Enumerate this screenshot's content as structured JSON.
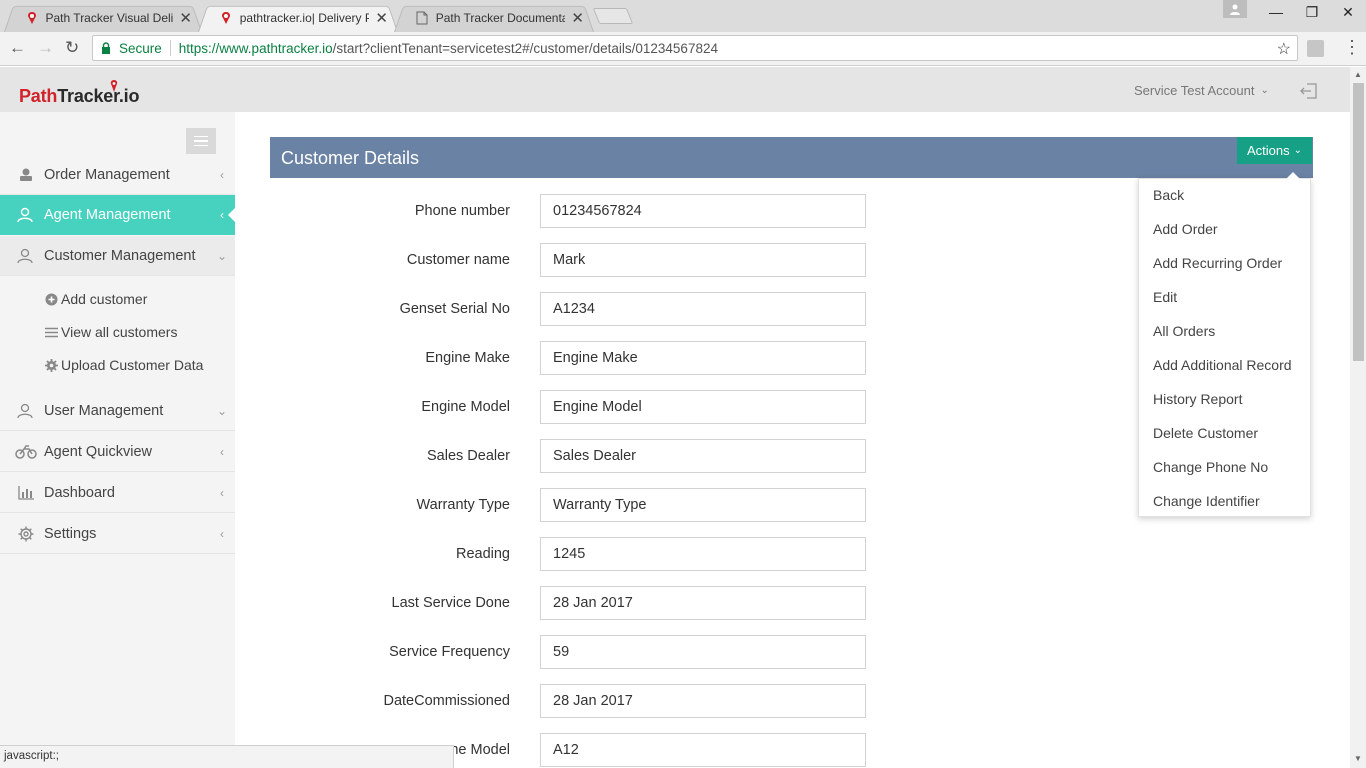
{
  "browser": {
    "tabs": [
      {
        "title": "Path Tracker Visual Delive",
        "active": false
      },
      {
        "title": "pathtracker.io| Delivery P",
        "active": true
      },
      {
        "title": "Path Tracker Documentat",
        "active": false
      }
    ],
    "secure_label": "Secure",
    "url_host": "https://www.pathtracker.io",
    "url_path": "/start?clientTenant=servicetest2#/customer/details/01234567824",
    "status_text": "javascript:;"
  },
  "header": {
    "logo_part1": "Path",
    "logo_part2": "Tracker.io",
    "account_label": "Service Test Account"
  },
  "sidebar": {
    "items": [
      {
        "label": "Order Management",
        "icon": "order-icon"
      },
      {
        "label": "Agent Management",
        "icon": "agent-icon"
      },
      {
        "label": "Customer Management",
        "icon": "customer-icon"
      },
      {
        "label": "User Management",
        "icon": "user-icon"
      },
      {
        "label": "Agent Quickview",
        "icon": "bike-icon"
      },
      {
        "label": "Dashboard",
        "icon": "bar-chart-icon"
      },
      {
        "label": "Settings",
        "icon": "gear-icon"
      }
    ],
    "sub_items": [
      {
        "label": "Add customer",
        "icon": "plus-circle-icon"
      },
      {
        "label": "View all customers",
        "icon": "list-icon"
      },
      {
        "label": "Upload Customer Data",
        "icon": "gear-icon"
      }
    ]
  },
  "panel": {
    "title": "Customer Details",
    "actions_label": "Actions"
  },
  "actions_menu": [
    "Back",
    "Add Order",
    "Add Recurring Order",
    "Edit",
    "All Orders",
    "Add Additional Record",
    "History Report",
    "Delete Customer",
    "Change Phone No",
    "Change Identifier"
  ],
  "fields": [
    {
      "label": "Phone number",
      "value": "01234567824"
    },
    {
      "label": "Customer name",
      "value": "Mark"
    },
    {
      "label": "Genset Serial No",
      "value": "A1234"
    },
    {
      "label": "Engine Make",
      "value": "Engine Make"
    },
    {
      "label": "Engine Model",
      "value": "Engine Model"
    },
    {
      "label": "Sales Dealer",
      "value": "Sales Dealer"
    },
    {
      "label": "Warranty Type",
      "value": "Warranty Type"
    },
    {
      "label": "Reading",
      "value": "1245"
    },
    {
      "label": "Last Service Done",
      "value": "28 Jan 2017"
    },
    {
      "label": "Service Frequency",
      "value": "59"
    },
    {
      "label": "DateCommissioned",
      "value": "28 Jan 2017"
    },
    {
      "label": "ne Model",
      "value": "A12"
    }
  ],
  "colors": {
    "active_nav": "#47d1bf",
    "panel_header": "#6a82a3",
    "actions_button": "#16a085",
    "logo_red": "#d2232a",
    "secure_green": "#0b8043"
  }
}
